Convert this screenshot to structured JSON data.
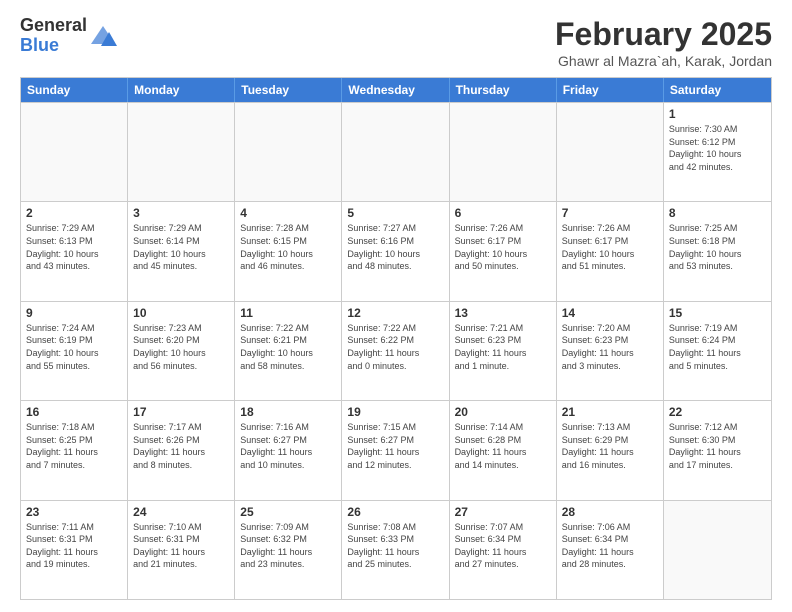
{
  "logo": {
    "general": "General",
    "blue": "Blue"
  },
  "title": "February 2025",
  "location": "Ghawr al Mazra`ah, Karak, Jordan",
  "days_of_week": [
    "Sunday",
    "Monday",
    "Tuesday",
    "Wednesday",
    "Thursday",
    "Friday",
    "Saturday"
  ],
  "weeks": [
    [
      {
        "day": "",
        "info": ""
      },
      {
        "day": "",
        "info": ""
      },
      {
        "day": "",
        "info": ""
      },
      {
        "day": "",
        "info": ""
      },
      {
        "day": "",
        "info": ""
      },
      {
        "day": "",
        "info": ""
      },
      {
        "day": "1",
        "info": "Sunrise: 7:30 AM\nSunset: 6:12 PM\nDaylight: 10 hours\nand 42 minutes."
      }
    ],
    [
      {
        "day": "2",
        "info": "Sunrise: 7:29 AM\nSunset: 6:13 PM\nDaylight: 10 hours\nand 43 minutes."
      },
      {
        "day": "3",
        "info": "Sunrise: 7:29 AM\nSunset: 6:14 PM\nDaylight: 10 hours\nand 45 minutes."
      },
      {
        "day": "4",
        "info": "Sunrise: 7:28 AM\nSunset: 6:15 PM\nDaylight: 10 hours\nand 46 minutes."
      },
      {
        "day": "5",
        "info": "Sunrise: 7:27 AM\nSunset: 6:16 PM\nDaylight: 10 hours\nand 48 minutes."
      },
      {
        "day": "6",
        "info": "Sunrise: 7:26 AM\nSunset: 6:17 PM\nDaylight: 10 hours\nand 50 minutes."
      },
      {
        "day": "7",
        "info": "Sunrise: 7:26 AM\nSunset: 6:17 PM\nDaylight: 10 hours\nand 51 minutes."
      },
      {
        "day": "8",
        "info": "Sunrise: 7:25 AM\nSunset: 6:18 PM\nDaylight: 10 hours\nand 53 minutes."
      }
    ],
    [
      {
        "day": "9",
        "info": "Sunrise: 7:24 AM\nSunset: 6:19 PM\nDaylight: 10 hours\nand 55 minutes."
      },
      {
        "day": "10",
        "info": "Sunrise: 7:23 AM\nSunset: 6:20 PM\nDaylight: 10 hours\nand 56 minutes."
      },
      {
        "day": "11",
        "info": "Sunrise: 7:22 AM\nSunset: 6:21 PM\nDaylight: 10 hours\nand 58 minutes."
      },
      {
        "day": "12",
        "info": "Sunrise: 7:22 AM\nSunset: 6:22 PM\nDaylight: 11 hours\nand 0 minutes."
      },
      {
        "day": "13",
        "info": "Sunrise: 7:21 AM\nSunset: 6:23 PM\nDaylight: 11 hours\nand 1 minute."
      },
      {
        "day": "14",
        "info": "Sunrise: 7:20 AM\nSunset: 6:23 PM\nDaylight: 11 hours\nand 3 minutes."
      },
      {
        "day": "15",
        "info": "Sunrise: 7:19 AM\nSunset: 6:24 PM\nDaylight: 11 hours\nand 5 minutes."
      }
    ],
    [
      {
        "day": "16",
        "info": "Sunrise: 7:18 AM\nSunset: 6:25 PM\nDaylight: 11 hours\nand 7 minutes."
      },
      {
        "day": "17",
        "info": "Sunrise: 7:17 AM\nSunset: 6:26 PM\nDaylight: 11 hours\nand 8 minutes."
      },
      {
        "day": "18",
        "info": "Sunrise: 7:16 AM\nSunset: 6:27 PM\nDaylight: 11 hours\nand 10 minutes."
      },
      {
        "day": "19",
        "info": "Sunrise: 7:15 AM\nSunset: 6:27 PM\nDaylight: 11 hours\nand 12 minutes."
      },
      {
        "day": "20",
        "info": "Sunrise: 7:14 AM\nSunset: 6:28 PM\nDaylight: 11 hours\nand 14 minutes."
      },
      {
        "day": "21",
        "info": "Sunrise: 7:13 AM\nSunset: 6:29 PM\nDaylight: 11 hours\nand 16 minutes."
      },
      {
        "day": "22",
        "info": "Sunrise: 7:12 AM\nSunset: 6:30 PM\nDaylight: 11 hours\nand 17 minutes."
      }
    ],
    [
      {
        "day": "23",
        "info": "Sunrise: 7:11 AM\nSunset: 6:31 PM\nDaylight: 11 hours\nand 19 minutes."
      },
      {
        "day": "24",
        "info": "Sunrise: 7:10 AM\nSunset: 6:31 PM\nDaylight: 11 hours\nand 21 minutes."
      },
      {
        "day": "25",
        "info": "Sunrise: 7:09 AM\nSunset: 6:32 PM\nDaylight: 11 hours\nand 23 minutes."
      },
      {
        "day": "26",
        "info": "Sunrise: 7:08 AM\nSunset: 6:33 PM\nDaylight: 11 hours\nand 25 minutes."
      },
      {
        "day": "27",
        "info": "Sunrise: 7:07 AM\nSunset: 6:34 PM\nDaylight: 11 hours\nand 27 minutes."
      },
      {
        "day": "28",
        "info": "Sunrise: 7:06 AM\nSunset: 6:34 PM\nDaylight: 11 hours\nand 28 minutes."
      },
      {
        "day": "",
        "info": ""
      }
    ]
  ]
}
